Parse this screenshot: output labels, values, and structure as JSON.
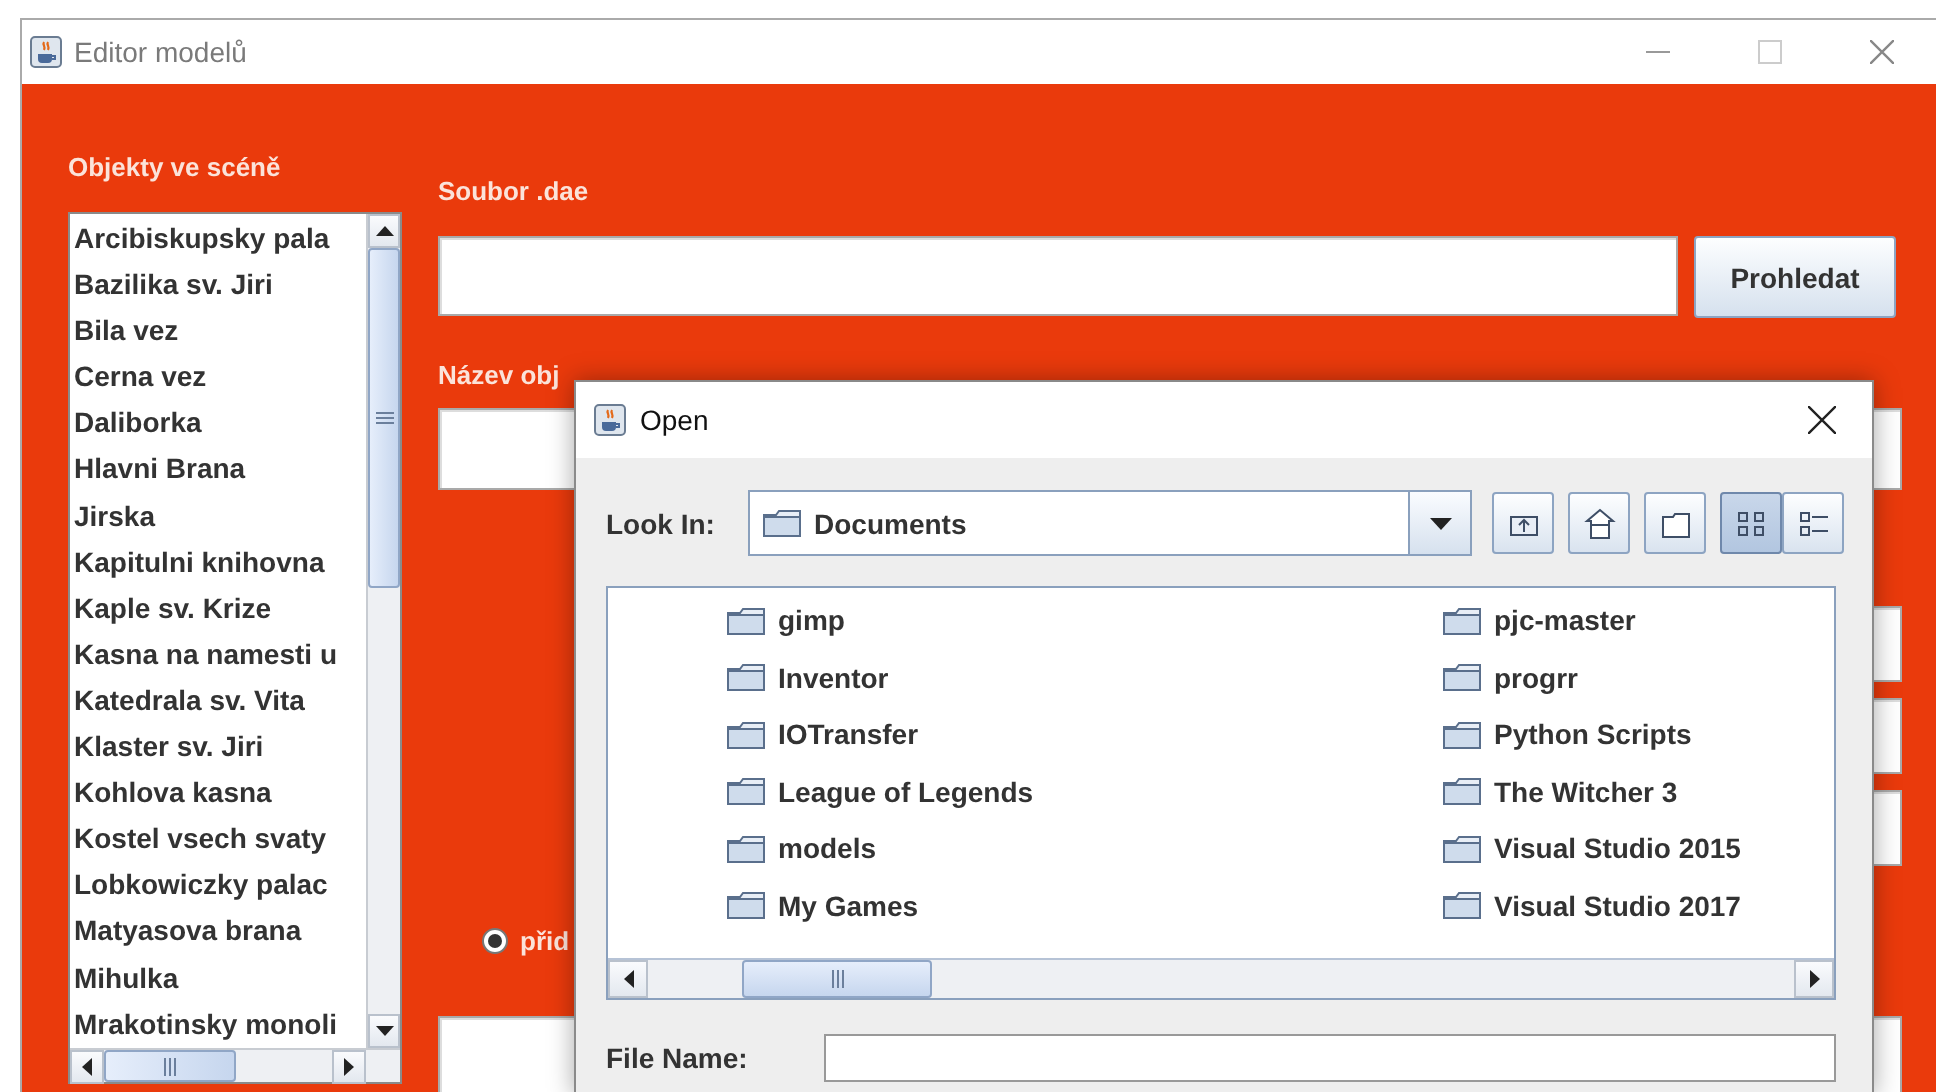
{
  "window": {
    "title": "Editor modelů"
  },
  "objects_panel": {
    "label": "Objekty ve scéně",
    "items": [
      {
        "name": "Arcibiskupsky pala"
      },
      {
        "name": "Bazilika sv. Jiri"
      },
      {
        "name": "Bila vez"
      },
      {
        "name": "Cerna vez"
      },
      {
        "name": "Daliborka"
      },
      {
        "name": "Hlavni Brana"
      },
      {
        "name": "Jirska"
      },
      {
        "name": "Kapitulni knihovna"
      },
      {
        "name": "Kaple sv. Krize"
      },
      {
        "name": "Kasna na namesti u"
      },
      {
        "name": "Katedrala sv. Vita"
      },
      {
        "name": "Klaster sv. Jiri"
      },
      {
        "name": "Kohlova kasna"
      },
      {
        "name": "Kostel vsech svaty"
      },
      {
        "name": "Lobkowiczky palac"
      },
      {
        "name": "Matyasova brana"
      },
      {
        "name": "Mihulka"
      },
      {
        "name": "Mrakotinsky monoli"
      }
    ]
  },
  "editor": {
    "file_label": "Soubor .dae",
    "browse_button": "Prohledat",
    "name_label": "Název obj",
    "radio": {
      "label": "přid",
      "selected": true
    }
  },
  "dialog": {
    "title": "Open",
    "look_in_label": "Look In:",
    "look_in": "Documents",
    "toolbar": [
      {
        "kind": "up"
      },
      {
        "kind": "home"
      },
      {
        "kind": "new-folder"
      },
      {
        "kind": "list",
        "selected": true
      },
      {
        "kind": "details",
        "selected": false
      }
    ],
    "files": [
      "gimp",
      "Inventor",
      "IOTransfer",
      "League of Legends",
      "models",
      "My Games",
      "pjc-master",
      "progrr",
      "Python Scripts",
      "The Witcher 3",
      "Visual Studio 2015",
      "Visual Studio 2017"
    ],
    "file_name_label": "File Name:"
  }
}
